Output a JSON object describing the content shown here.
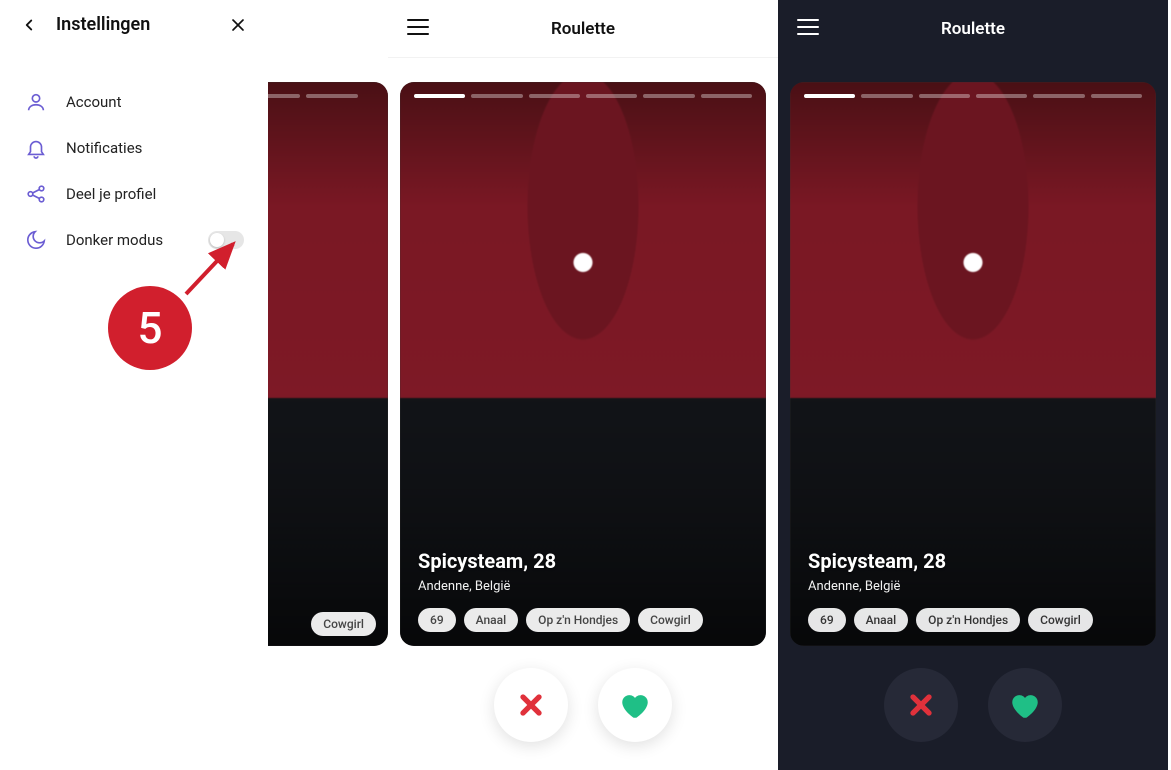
{
  "settings": {
    "title": "Instellingen",
    "items": [
      {
        "label": "Account"
      },
      {
        "label": "Notificaties"
      },
      {
        "label": "Deel je profiel"
      },
      {
        "label": "Donker modus"
      }
    ],
    "annotation_number": "5"
  },
  "phone": {
    "title": "Roulette",
    "profile": {
      "name_age": "Spicysteam, 28",
      "location": "Andenne, België",
      "tags": [
        "69",
        "Anaal",
        "Op z'n Hondjes",
        "Cowgirl"
      ]
    }
  },
  "partial": {
    "visible_tag": "Cowgirl"
  },
  "colors": {
    "accent_purple": "#6b5dd3",
    "like_green": "#1fbf86",
    "nope_red": "#e0313b",
    "annotation_red": "#d11f2d",
    "dark_bg": "#1a1d29"
  }
}
